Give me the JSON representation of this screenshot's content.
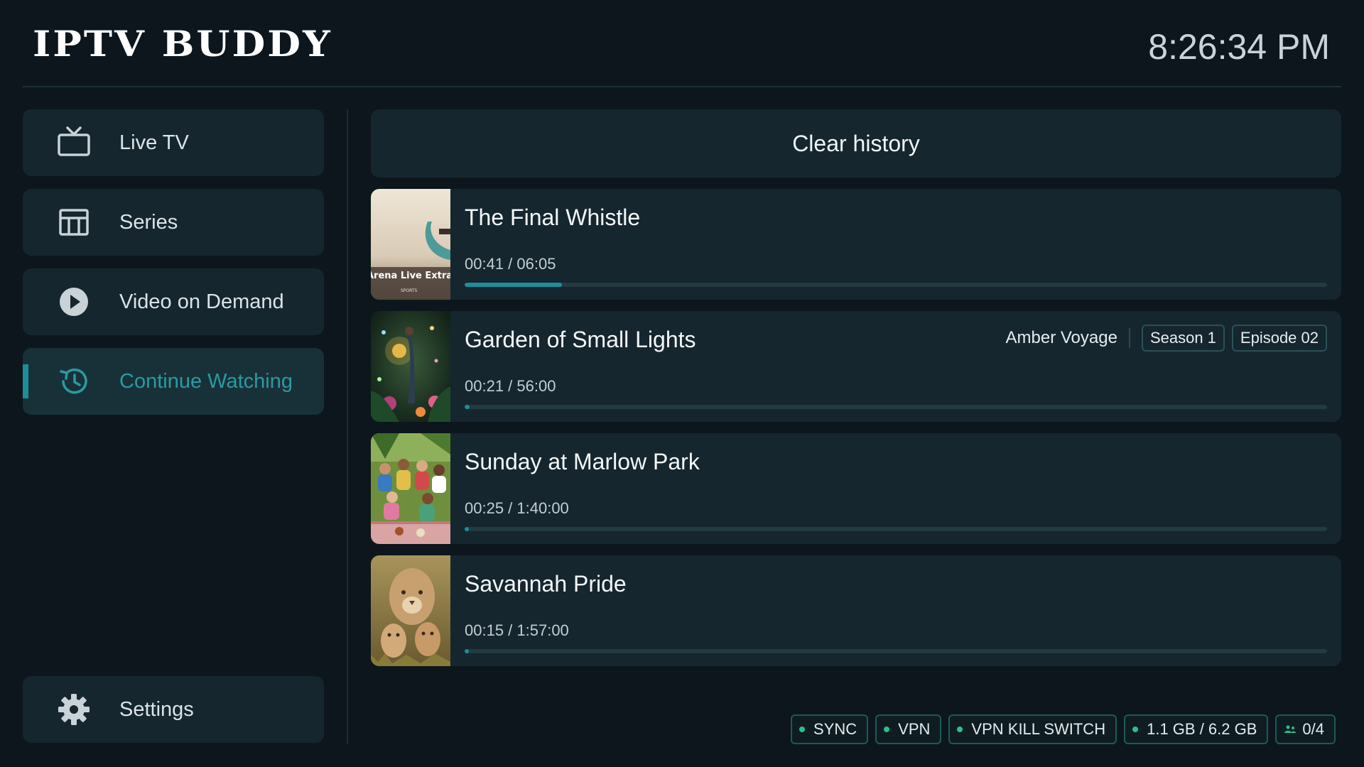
{
  "app": {
    "title": "IPTV BUDDY",
    "clock": "8:26:34 PM"
  },
  "sidebar": {
    "items": [
      {
        "label": "Live TV",
        "icon": "tv-icon",
        "active": false
      },
      {
        "label": "Series",
        "icon": "grid-icon",
        "active": false
      },
      {
        "label": "Video on Demand",
        "icon": "play-circle-icon",
        "active": false
      },
      {
        "label": "Continue Watching",
        "icon": "history-icon",
        "active": true
      }
    ],
    "settings": {
      "label": "Settings",
      "icon": "gear-icon"
    }
  },
  "main": {
    "clear_history_label": "Clear history",
    "history": [
      {
        "title": "The Final Whistle",
        "time": "00:41 / 06:05",
        "progress": 0.113,
        "thumbnail_text": "Arena Live Extra",
        "thumbnail_subtext": "SPORTS"
      },
      {
        "title": "Garden of Small Lights",
        "time": "00:21 / 56:00",
        "progress": 0.006,
        "channel": "Amber Voyage",
        "season": "Season 1",
        "episode": "Episode 02"
      },
      {
        "title": "Sunday at Marlow Park",
        "time": "00:25 / 1:40:00",
        "progress": 0.004
      },
      {
        "title": "Savannah Pride",
        "time": "00:15 / 1:57:00",
        "progress": 0.002
      }
    ]
  },
  "status": {
    "sync": "SYNC",
    "vpn": "VPN",
    "kill_switch": "VPN KILL SWITCH",
    "storage": "1.1 GB / 6.2 GB",
    "users": "0/4"
  },
  "colors": {
    "background": "#0c161c",
    "panel": "#15262e",
    "accent": "#1f8c97",
    "status_dot": "#2bc18a"
  }
}
